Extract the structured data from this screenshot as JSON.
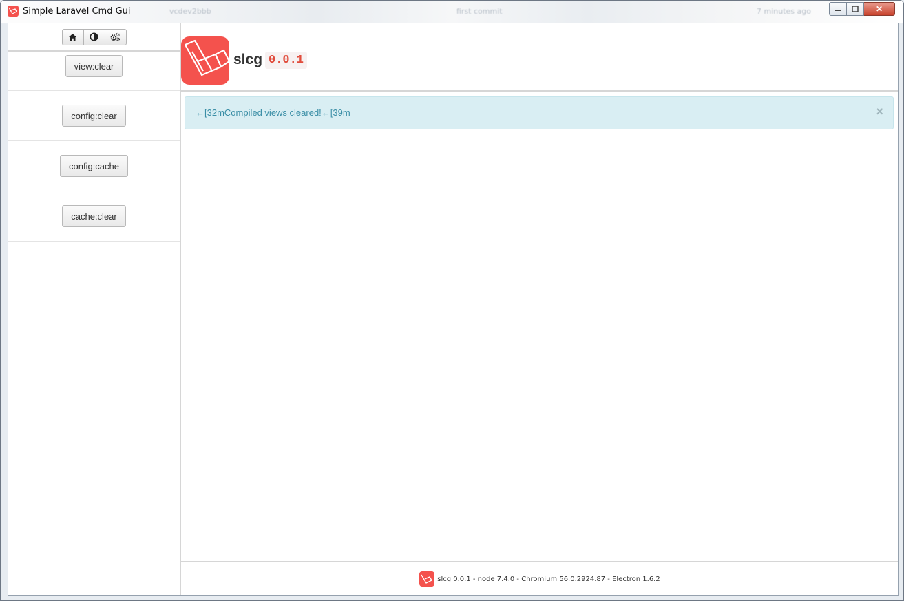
{
  "window": {
    "title": "Simple Laravel Cmd Gui",
    "background_ghost": [
      "vcdev2bbb",
      "first commit",
      "7 minutes ago"
    ],
    "controls": {
      "minimize": "▭",
      "maximize": "□",
      "close": "✕"
    }
  },
  "toolbar": {
    "icons": [
      "home-icon",
      "contrast-icon",
      "gears-icon"
    ]
  },
  "commands": [
    {
      "label": "view:clear"
    },
    {
      "label": "config:clear"
    },
    {
      "label": "config:cache"
    },
    {
      "label": "cache:clear"
    }
  ],
  "header": {
    "app_name": "slcg",
    "version": "0.0.1"
  },
  "alert": {
    "message": "←[32mCompiled views cleared!←[39m",
    "close": "×"
  },
  "footer": {
    "text": "slcg 0.0.1 - node 7.4.0 - Chromium 56.0.2924.87 - Electron 1.6.2"
  },
  "colors": {
    "brand": "#f4524d",
    "alert_bg": "#d9eef3",
    "alert_text": "#3a8ea6"
  }
}
